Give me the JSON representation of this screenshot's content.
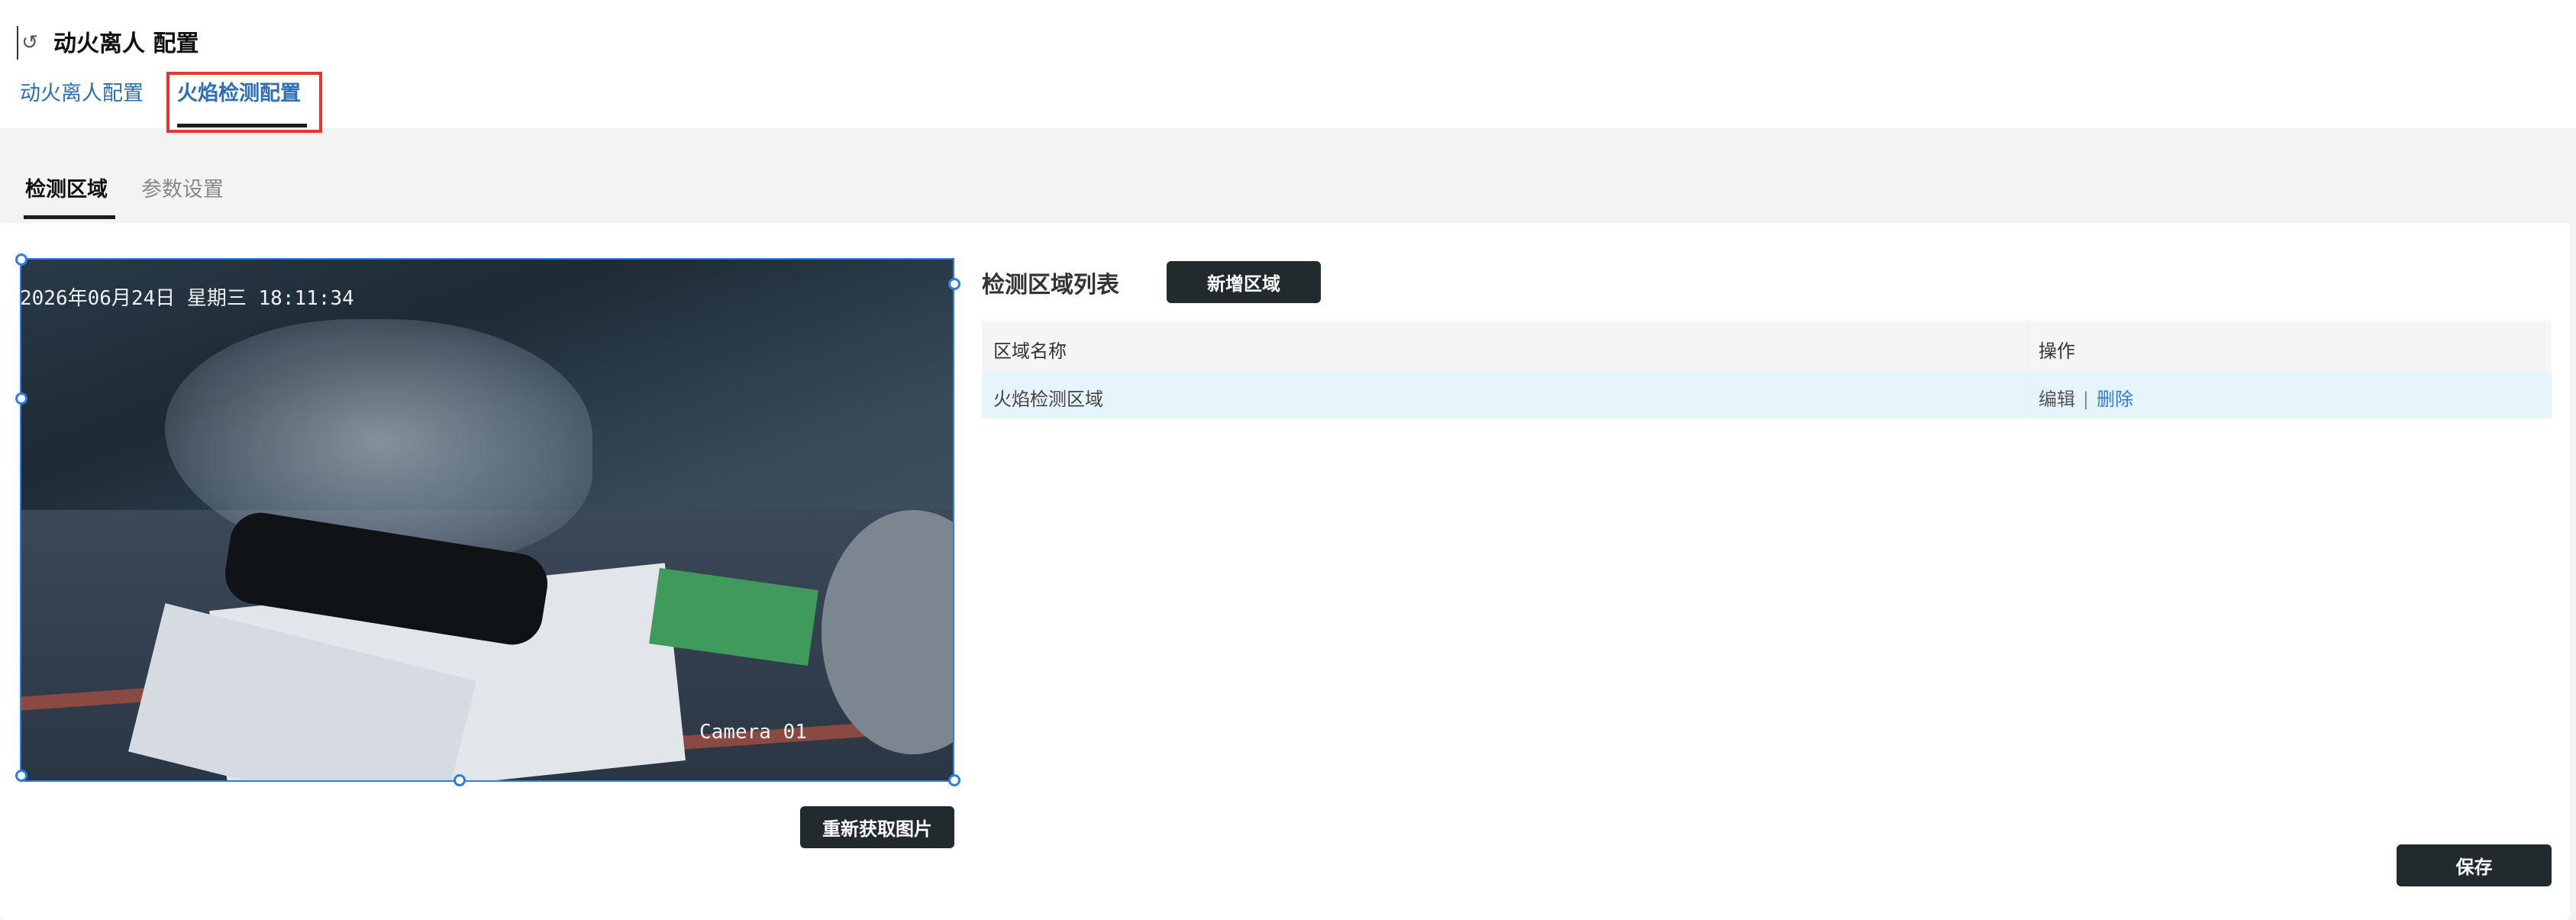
{
  "header": {
    "title": "动火离人 配置",
    "tabs": [
      {
        "label": "动火离人配置",
        "active": false
      },
      {
        "label": "火焰检测配置",
        "active": true
      }
    ]
  },
  "sub_tabs": [
    {
      "label": "检测区域",
      "active": true
    },
    {
      "label": "参数设置",
      "active": false
    }
  ],
  "camera": {
    "timestamp": "2026年06月24日  星期三  18:11:34",
    "name": "Camera 01"
  },
  "buttons": {
    "refresh_image": "重新获取图片",
    "add_region": "新增区域",
    "save": "保存"
  },
  "region_list": {
    "title": "检测区域列表",
    "columns": [
      "区域名称",
      "操作"
    ],
    "rows": [
      {
        "name": "火焰检测区域",
        "edit": "编辑",
        "separator": "|",
        "delete": "删除"
      }
    ]
  },
  "colors": {
    "accent": "#2f7de1",
    "tab_link": "#2d6fb0",
    "highlight": "#e53535",
    "dark_button": "#232a2e",
    "row_selected": "#e6f4fb"
  }
}
